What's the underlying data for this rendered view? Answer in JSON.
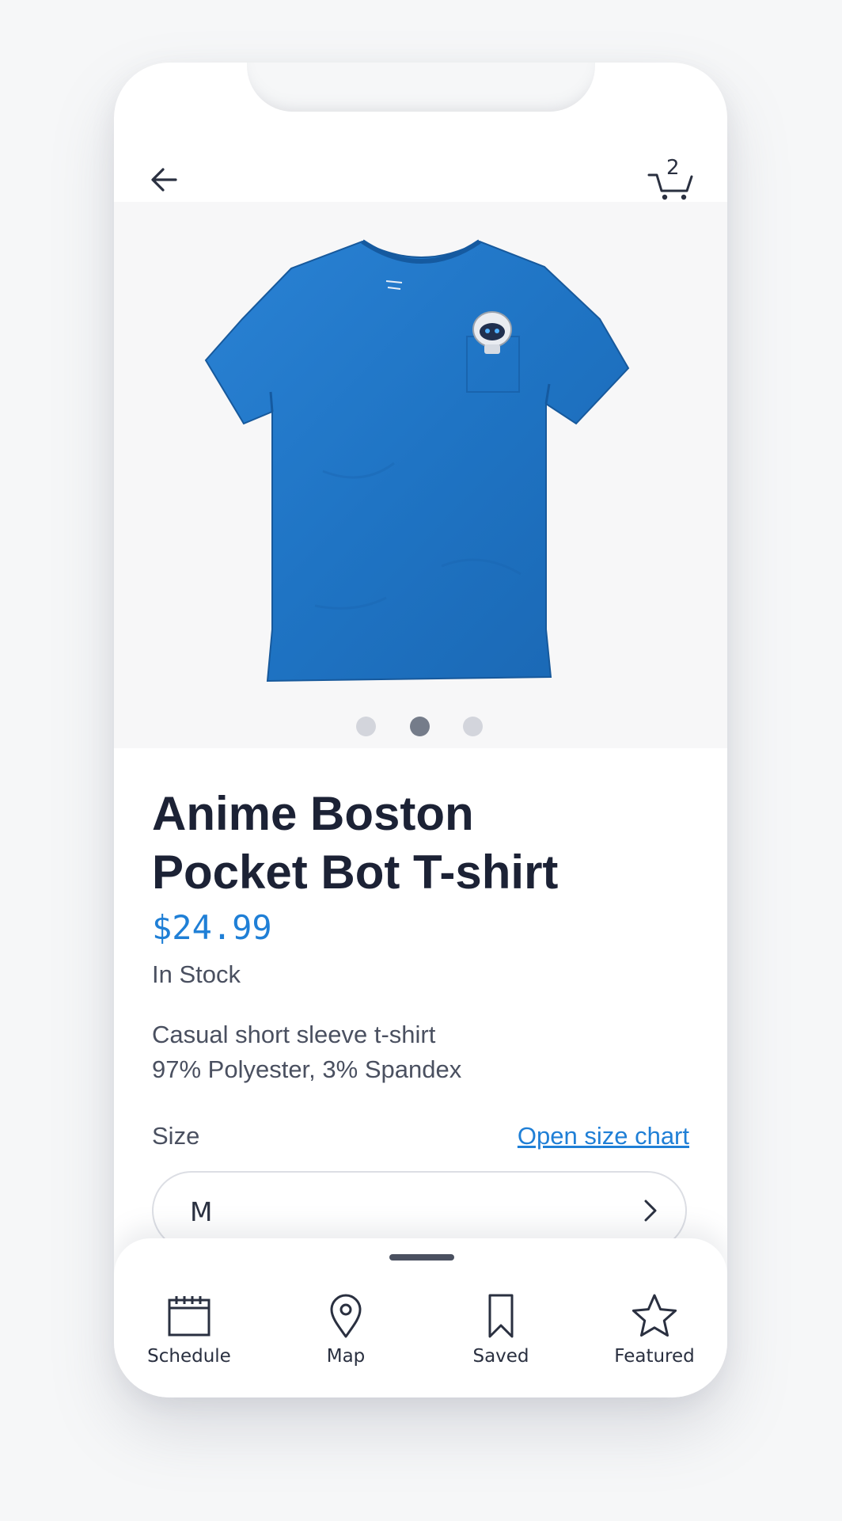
{
  "header": {
    "cart_count": "2"
  },
  "product": {
    "image_icon": "blue-tshirt-image",
    "title_line1": "Anime Boston",
    "title_line2": "Pocket Bot T-shirt",
    "price": "$24.99",
    "stock": "In Stock",
    "desc_line1": "Casual short sleeve t-shirt",
    "desc_line2": "97% Polyester, 3% Spandex",
    "gallery_active_index": 1,
    "gallery_count": 3
  },
  "size": {
    "label": "Size",
    "chart_link": "Open size chart",
    "selected": "M"
  },
  "nav": {
    "items": [
      {
        "label": "Schedule",
        "icon": "calendar-icon"
      },
      {
        "label": "Map",
        "icon": "map-pin-icon"
      },
      {
        "label": "Saved",
        "icon": "bookmark-icon"
      },
      {
        "label": "Featured",
        "icon": "star-icon"
      }
    ]
  },
  "colors": {
    "accent": "#1f7fd6",
    "shirt": "#1f74c4",
    "text_dark": "#1c2235",
    "text_muted": "#4a5060"
  }
}
